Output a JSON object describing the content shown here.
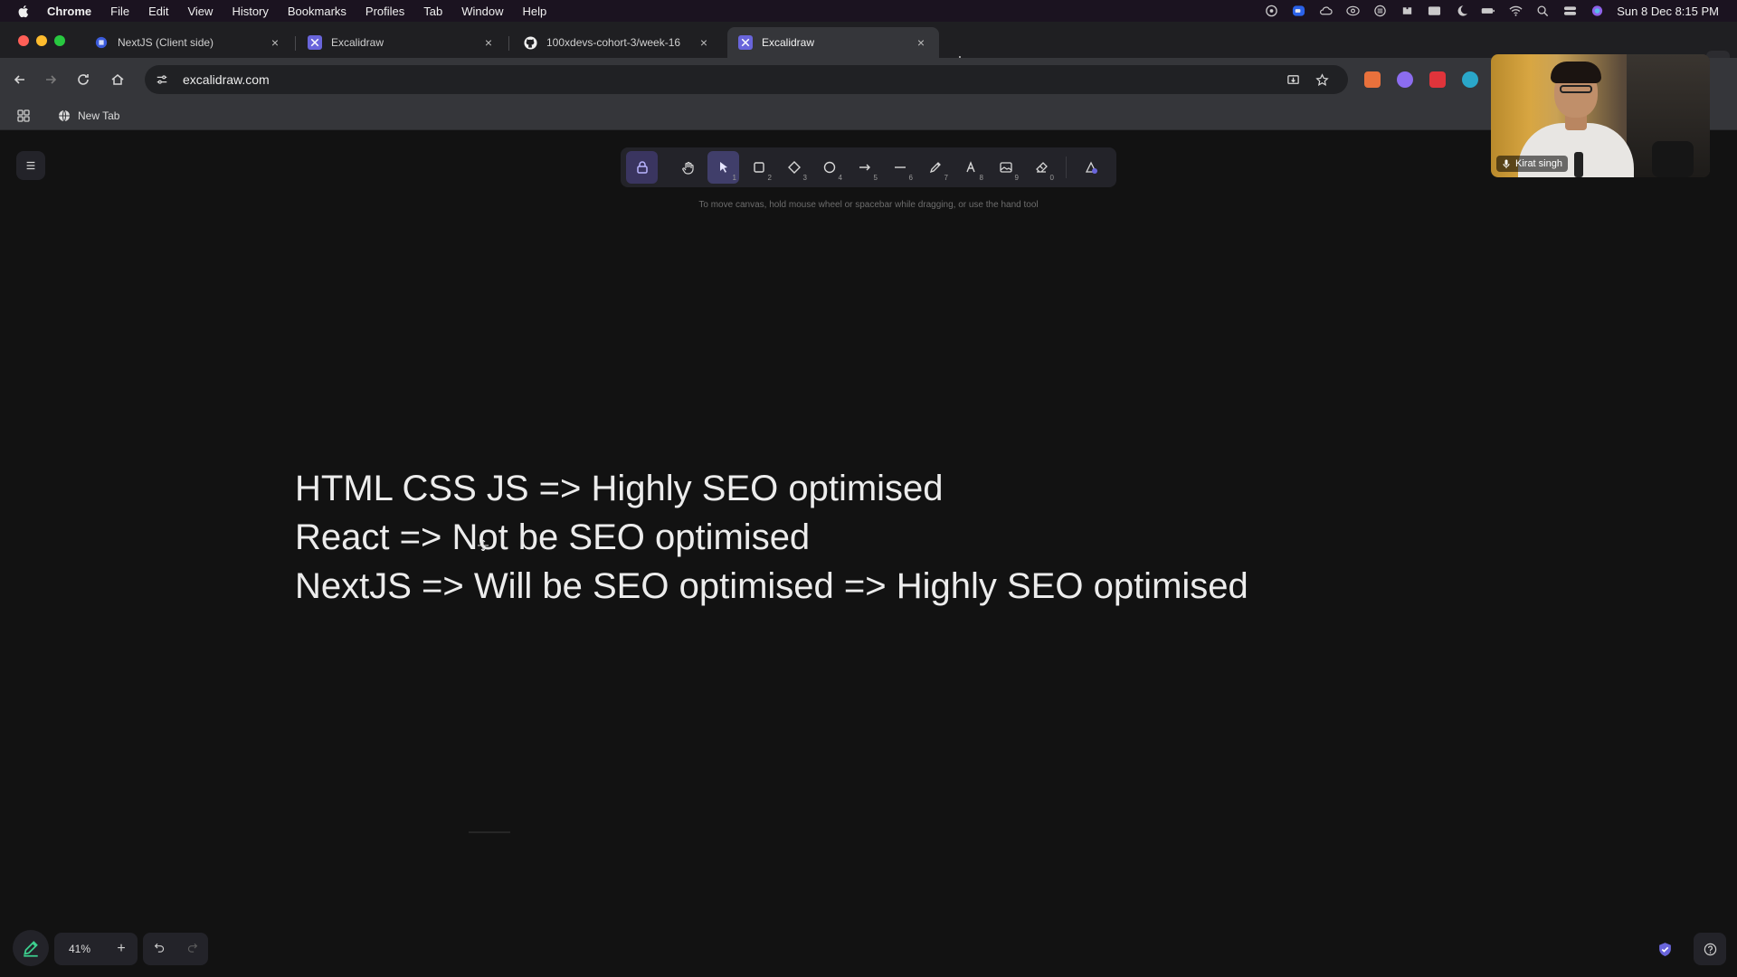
{
  "menubar": {
    "app": "Chrome",
    "menus": [
      "File",
      "Edit",
      "View",
      "History",
      "Bookmarks",
      "Profiles",
      "Tab",
      "Window",
      "Help"
    ],
    "clock": "Sun 8 Dec  8:15 PM"
  },
  "tabs": [
    {
      "title": "NextJS (Client side)",
      "favicon": "notion-icon",
      "active": false
    },
    {
      "title": "Excalidraw",
      "favicon": "excalidraw-icon",
      "active": false
    },
    {
      "title": "100xdevs-cohort-3/week-16",
      "favicon": "github-icon",
      "active": false
    },
    {
      "title": "Excalidraw",
      "favicon": "excalidraw-icon",
      "active": true
    }
  ],
  "omnibox": {
    "url": "excalidraw.com"
  },
  "bookmarks": {
    "items": [
      {
        "label": "New Tab"
      }
    ]
  },
  "excalidraw": {
    "hint": "To move canvas, hold mouse wheel or spacebar while dragging, or use the hand tool",
    "tools": [
      {
        "name": "hand",
        "key": ""
      },
      {
        "name": "selection",
        "key": "1"
      },
      {
        "name": "rectangle",
        "key": "2"
      },
      {
        "name": "diamond",
        "key": "3"
      },
      {
        "name": "ellipse",
        "key": "4"
      },
      {
        "name": "arrow",
        "key": "5"
      },
      {
        "name": "line",
        "key": "6"
      },
      {
        "name": "draw",
        "key": "7"
      },
      {
        "name": "text",
        "key": "8"
      },
      {
        "name": "image",
        "key": "9"
      },
      {
        "name": "eraser",
        "key": "0"
      }
    ],
    "canvas_text": [
      "HTML CSS JS => Highly SEO optimised",
      "React => Not be SEO optimised",
      "NextJS => Will be SEO optimised => Highly SEO optimised"
    ],
    "zoom": "41%",
    "zoom_in": "+"
  },
  "webcam": {
    "name": "Kirat singh"
  },
  "colors": {
    "canvas_bg": "#121212",
    "accent": "#403e6a",
    "text": "#ececec"
  }
}
